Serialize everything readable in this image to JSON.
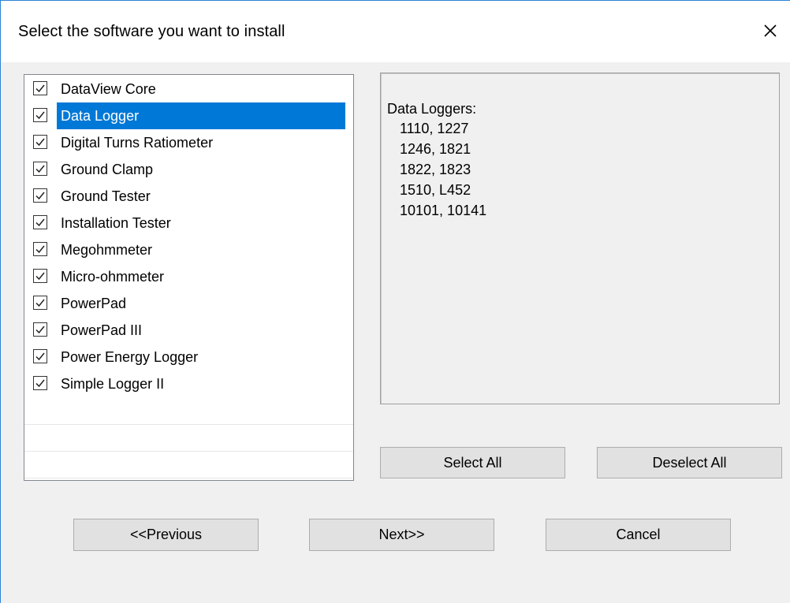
{
  "window": {
    "title": "Select the software you want to install",
    "close_icon": "close-icon"
  },
  "software_list": {
    "items": [
      {
        "label": "DataView Core",
        "checked": true,
        "selected": false
      },
      {
        "label": "Data Logger",
        "checked": true,
        "selected": true
      },
      {
        "label": "Digital Turns Ratiometer",
        "checked": true,
        "selected": false
      },
      {
        "label": "Ground Clamp",
        "checked": true,
        "selected": false
      },
      {
        "label": "Ground Tester",
        "checked": true,
        "selected": false
      },
      {
        "label": "Installation Tester",
        "checked": true,
        "selected": false
      },
      {
        "label": "Megohmmeter",
        "checked": true,
        "selected": false
      },
      {
        "label": "Micro-ohmmeter",
        "checked": true,
        "selected": false
      },
      {
        "label": "PowerPad",
        "checked": true,
        "selected": false
      },
      {
        "label": "PowerPad III",
        "checked": true,
        "selected": false
      },
      {
        "label": "Power Energy Logger",
        "checked": true,
        "selected": false
      },
      {
        "label": "Simple Logger II",
        "checked": true,
        "selected": false
      }
    ]
  },
  "description": {
    "title": "Data Loggers:",
    "lines": [
      "1110, 1227",
      "1246, 1821",
      "1822, 1823",
      "1510, L452",
      "10101, 10141"
    ]
  },
  "selection_buttons": {
    "select_all": "Select All",
    "deselect_all": "Deselect All"
  },
  "nav_buttons": {
    "previous": "<<Previous",
    "next": "Next>>",
    "cancel": "Cancel"
  },
  "colors": {
    "selection_highlight": "#0078d7",
    "window_border": "#2a84d6",
    "dialog_background": "#f0f0f0"
  }
}
